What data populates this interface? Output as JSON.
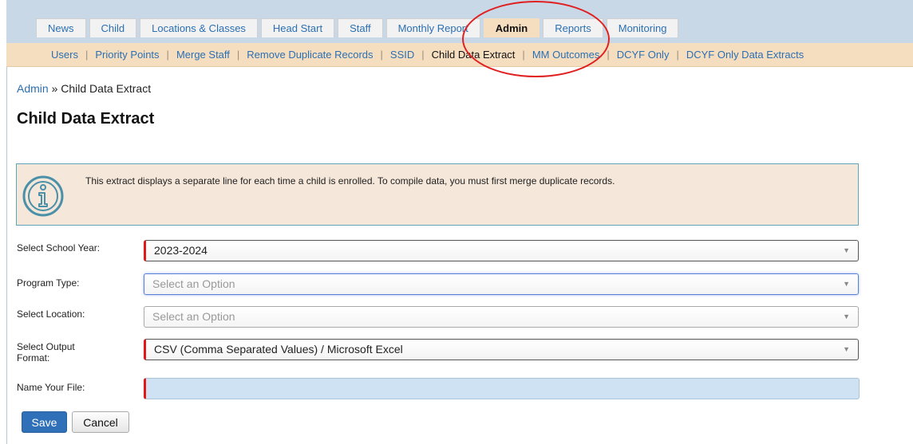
{
  "nav": {
    "tabs": [
      {
        "label": "News"
      },
      {
        "label": "Child"
      },
      {
        "label": "Locations & Classes"
      },
      {
        "label": "Head Start"
      },
      {
        "label": "Staff"
      },
      {
        "label": "Monthly Report"
      },
      {
        "label": "Admin",
        "active": true
      },
      {
        "label": "Reports"
      },
      {
        "label": "Monitoring"
      }
    ],
    "subitems": [
      {
        "label": "Users"
      },
      {
        "label": "Priority Points"
      },
      {
        "label": "Merge Staff"
      },
      {
        "label": "Remove Duplicate Records"
      },
      {
        "label": "SSID"
      },
      {
        "label": "Child Data Extract",
        "active": true
      },
      {
        "label": "MM Outcomes"
      },
      {
        "label": "DCYF Only"
      },
      {
        "label": "DCYF Only Data Extracts"
      }
    ]
  },
  "breadcrumb": {
    "parent": "Admin",
    "separator": " » ",
    "current": "Child Data Extract"
  },
  "page_title": "Child Data Extract",
  "info": {
    "icon": "info-circle-icon",
    "text": "This extract displays a separate line for each time a child is enrolled. To compile data, you must first merge duplicate records."
  },
  "form": {
    "school_year": {
      "label": "Select School Year:",
      "value": "2023-2024"
    },
    "program_type": {
      "label": "Program Type:",
      "placeholder": "Select an Option"
    },
    "location": {
      "label": "Select Location:",
      "placeholder": "Select an Option"
    },
    "output_format": {
      "label": "Select Output Format:",
      "value": "CSV (Comma Separated Values) / Microsoft Excel"
    },
    "file_name": {
      "label": "Name Your File:",
      "value": ""
    }
  },
  "buttons": {
    "save": "Save",
    "cancel": "Cancel"
  },
  "colors": {
    "accent": "#2f70b8",
    "tab_active": "#f5dec0",
    "annotation": "#e02020",
    "required": "#e01818"
  }
}
